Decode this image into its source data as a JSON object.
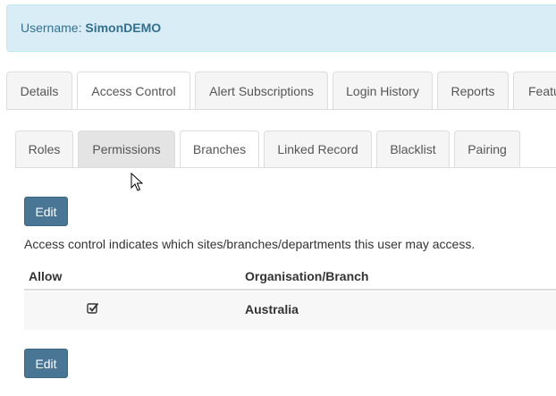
{
  "user": {
    "label": "Username:",
    "name": "SimonDEMO"
  },
  "main_tabs": [
    {
      "label": "Details"
    },
    {
      "label": "Access Control"
    },
    {
      "label": "Alert Subscriptions"
    },
    {
      "label": "Login History"
    },
    {
      "label": "Reports"
    },
    {
      "label": "Featu"
    }
  ],
  "sub_tabs": [
    {
      "label": "Roles"
    },
    {
      "label": "Permissions"
    },
    {
      "label": "Branches"
    },
    {
      "label": "Linked Record"
    },
    {
      "label": "Blacklist"
    },
    {
      "label": "Pairing"
    }
  ],
  "actions": {
    "edit_label": "Edit"
  },
  "description": "Access control indicates which sites/branches/departments this user may access.",
  "table": {
    "headers": {
      "allow": "Allow",
      "org": "Organisation/Branch"
    },
    "rows": [
      {
        "allowed": true,
        "org": "Australia"
      }
    ]
  },
  "icons": {
    "checkbox": "checked-checkbox-icon",
    "cursor": "mouse-pointer-icon"
  },
  "colors": {
    "banner_bg": "#d9edf7",
    "banner_text": "#31708f",
    "button_bg": "#4a7696"
  }
}
